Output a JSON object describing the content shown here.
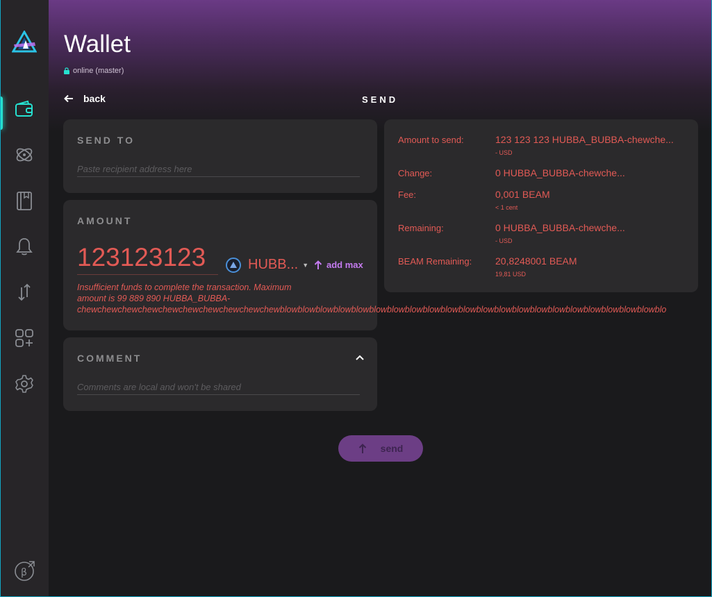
{
  "app": {
    "title": "Wallet",
    "status": "online (master)"
  },
  "sidebar": {
    "items": [
      {
        "name": "wallet",
        "icon": "wallet-icon",
        "active": true
      },
      {
        "name": "atomic-swap",
        "icon": "atom-icon",
        "active": false
      },
      {
        "name": "address-book",
        "icon": "book-icon",
        "active": false
      },
      {
        "name": "notifications",
        "icon": "bell-icon",
        "active": false
      },
      {
        "name": "transactions",
        "icon": "arrows-updown-icon",
        "active": false
      },
      {
        "name": "applications",
        "icon": "apps-add-icon",
        "active": false
      },
      {
        "name": "settings",
        "icon": "gear-icon",
        "active": false
      }
    ]
  },
  "header": {
    "back_label": "back",
    "page_heading": "SEND"
  },
  "send_to": {
    "label": "SEND TO",
    "placeholder": "Paste recipient address here"
  },
  "amount": {
    "label": "AMOUNT",
    "value": "123123123",
    "asset": "HUBB...",
    "add_max_label": "add max",
    "error_line1": "Insufficient funds to complete the transaction. Maximum",
    "error_line2": "amount is 99 889 890 HUBBA_BUBBA-",
    "error_line3": "chewchewchewchewchewchewchewchewchewchewblowblowblowblowblowblowblowblowblowblowblowblowblowblowblowblowblowblowblowblowblowblo"
  },
  "comment": {
    "label": "COMMENT",
    "placeholder": "Comments are local and won't be shared"
  },
  "summary": {
    "amount_label": "Amount to send:",
    "amount_value": "123 123 123  HUBBA_BUBBA-chewche...",
    "amount_sub": "- USD",
    "change_label": "Change:",
    "change_value": "0  HUBBA_BUBBA-chewche...",
    "fee_label": "Fee:",
    "fee_value": "0,001  BEAM",
    "fee_sub": "< 1 cent",
    "remaining_label": "Remaining:",
    "remaining_value": "0  HUBBA_BUBBA-chewche...",
    "remaining_sub": "- USD",
    "beam_remaining_label": "BEAM Remaining:",
    "beam_remaining_value": "20,8248001  BEAM",
    "beam_remaining_sub": "19,81 USD"
  },
  "actions": {
    "send_label": "send"
  },
  "colors": {
    "accent": "#26e0cf",
    "error": "#e25a55",
    "purple": "#c47bf0",
    "card_bg": "#2b2a2c",
    "page_bg": "#1a1a1c"
  }
}
